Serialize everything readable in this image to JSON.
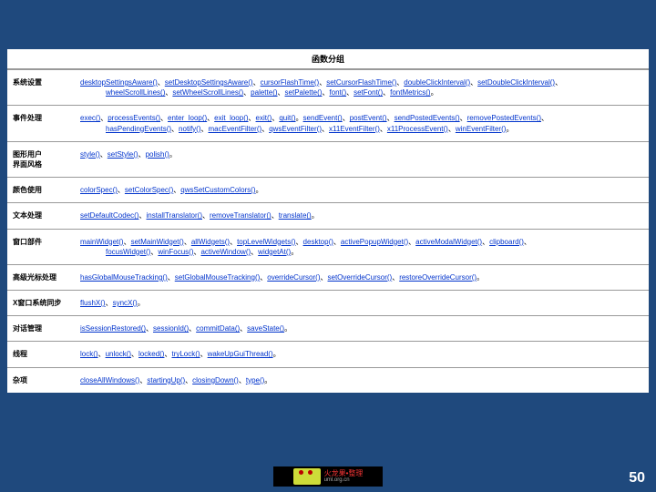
{
  "header": "函数分组",
  "rows": [
    {
      "category": "系统设置",
      "lines": [
        [
          "desktopSettingsAware()",
          "、",
          "setDesktopSettingsAware()",
          "、",
          "cursorFlashTime()",
          "、",
          "setCursorFlashTime()",
          "、",
          "doubleClickInterval()",
          "、",
          "setDoubleClickInterval()",
          "、"
        ],
        [
          "__indent__",
          "wheelScrollLines()",
          "、",
          "setWheelScrollLines()",
          "、",
          "palette()",
          "、",
          "setPalette()",
          "、",
          "font()",
          "、",
          "setFont()",
          "、",
          "fontMetrics()",
          "。"
        ]
      ]
    },
    {
      "category": "事件处理",
      "lines": [
        [
          "exec()",
          "、",
          "processEvents()",
          "、",
          "enter_loop()",
          "、",
          "exit_loop()",
          "、",
          "exit()",
          "、",
          "quit()",
          "。",
          "sendEvent()",
          "、",
          "postEvent()",
          "、",
          "sendPostedEvents()",
          "、",
          "removePostedEvents()",
          "、"
        ],
        [
          "__indent__",
          "hasPendingEvents()",
          "、",
          "notify()",
          "、",
          "macEventFilter()",
          "、",
          "qwsEventFilter()",
          "、",
          "x11EventFilter()",
          "、",
          "x11ProcessEvent()",
          "、",
          "winEventFilter()",
          "。"
        ]
      ]
    },
    {
      "category": "图形用户\n界面风格",
      "lines": [
        [
          "style()",
          "、",
          "setStyle()",
          "、",
          "polish()",
          "。"
        ]
      ]
    },
    {
      "category": "颜色使用",
      "lines": [
        [
          "colorSpec()",
          "、",
          "setColorSpec()",
          "、",
          "qwsSetCustomColors()",
          "。"
        ]
      ]
    },
    {
      "category": "文本处理",
      "lines": [
        [
          "setDefaultCodec()",
          "、",
          "installTranslator()",
          "、",
          "removeTranslator()",
          "、",
          "translate()",
          "。"
        ]
      ]
    },
    {
      "category": "窗口部件",
      "lines": [
        [
          "mainWidget()",
          "、",
          "setMainWidget()",
          "、",
          "allWidgets()",
          "、",
          "topLevelWidgets()",
          "、",
          "desktop()",
          "、",
          "activePopupWidget()",
          "、",
          "activeModalWidget()",
          "、",
          "clipboard()",
          "、"
        ],
        [
          "__indent__",
          "focusWidget()",
          "、",
          "winFocus()",
          "、",
          "activeWindow()",
          "、",
          "widgetAt()",
          "。"
        ]
      ]
    },
    {
      "category": "高级光标处理",
      "lines": [
        [
          "hasGlobalMouseTracking()",
          "、",
          "setGlobalMouseTracking()",
          "、",
          "overrideCursor()",
          "、",
          "setOverrideCursor()",
          "、",
          "restoreOverrideCursor()",
          "。"
        ]
      ]
    },
    {
      "category": "X窗口系统同步",
      "lines": [
        [
          "flushX()",
          "、",
          "syncX()",
          "。"
        ]
      ]
    },
    {
      "category": "对话管理",
      "lines": [
        [
          "isSessionRestored()",
          "、",
          "sessionId()",
          "、",
          "commitData()",
          "、",
          "saveState()",
          "。"
        ]
      ]
    },
    {
      "category": "线程",
      "lines": [
        [
          "lock()",
          "、",
          "unlock()",
          "、",
          "locked()",
          "、",
          "tryLock()",
          "、",
          "wakeUpGuiThread()",
          "。"
        ]
      ]
    },
    {
      "category": "杂项",
      "lines": [
        [
          "closeAllWindows()",
          "、",
          "startingUp()",
          "、",
          "closingDown()",
          "、",
          "type()",
          "。"
        ]
      ]
    }
  ],
  "logo": {
    "brand": "火龙果•整理",
    "sub": "uml.org.cn"
  },
  "page_number": "50"
}
